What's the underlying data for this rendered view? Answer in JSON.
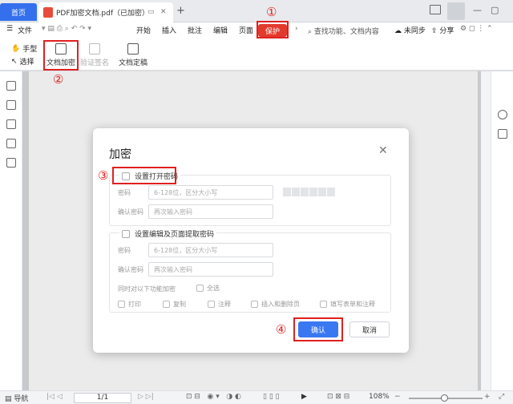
{
  "tabs": {
    "home": "首页",
    "doc_title": "PDF加密文档.pdf（已加密）",
    "add": "+"
  },
  "menu": {
    "file": "文件",
    "items": [
      "开始",
      "插入",
      "批注",
      "编辑",
      "页面",
      "保护"
    ],
    "search": "查找功能、文档内容",
    "unsync": "未同步",
    "share": "分享"
  },
  "ribbon": {
    "hand": "手型",
    "select": "选择",
    "encrypt": "文档加密",
    "verify": "验证签名",
    "finalize": "文档定稿"
  },
  "dialog": {
    "title": "加密",
    "open_pw_label": "设置打开密码",
    "pw_label": "密码",
    "pw_placeholder": "6-128位，区分大小写",
    "confirm_label": "确认密码",
    "confirm_placeholder": "再次输入密码",
    "edit_pw_label": "设置编辑及页面提取密码",
    "also_encrypt": "同时对以下功能加密",
    "select_all": "全选",
    "options": [
      "打印",
      "复制",
      "注释",
      "插入和删除页",
      "填写表单和注释"
    ],
    "ok": "确认",
    "cancel": "取消"
  },
  "annotations": [
    "①",
    "②",
    "③",
    "④"
  ],
  "status": {
    "nav": "导航",
    "page": "1/1",
    "zoom": "108%"
  },
  "colors": {
    "accent": "#3a78f2",
    "protect_tab": "#e23b2e",
    "annotation": "#e02020"
  }
}
